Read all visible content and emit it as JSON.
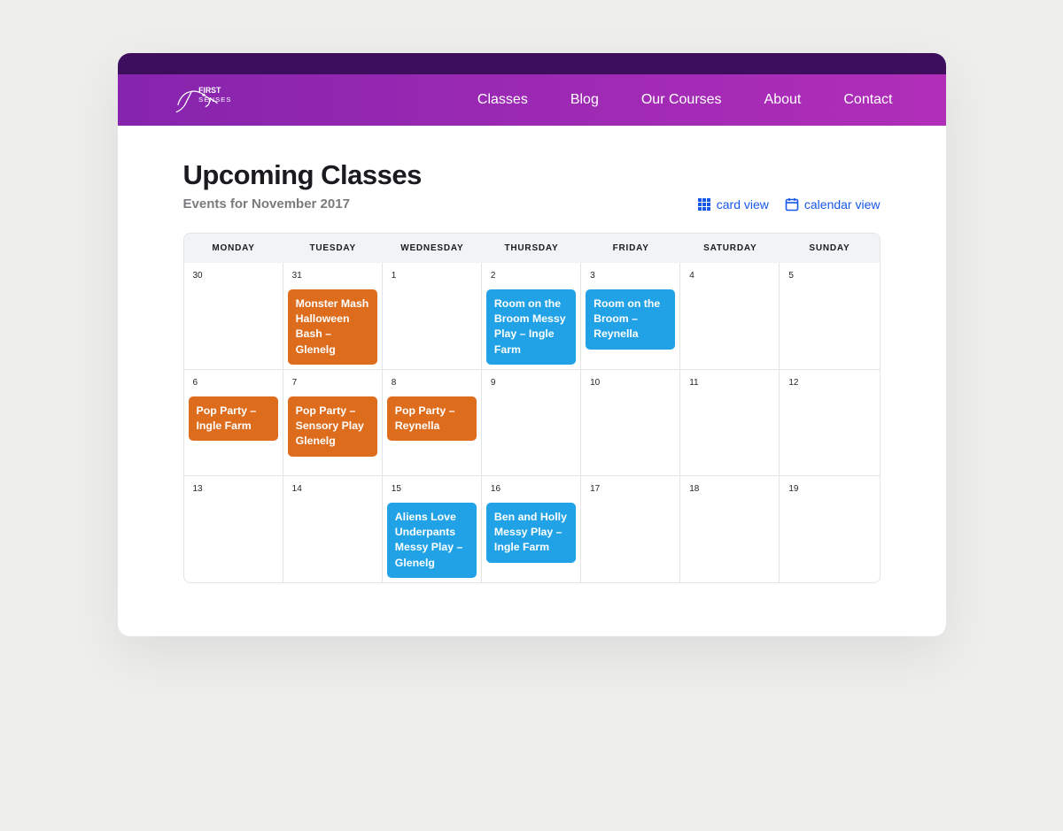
{
  "nav": {
    "logo_text": "FIRST SENSES",
    "links": [
      "Classes",
      "Blog",
      "Our Courses",
      "About",
      "Contact"
    ]
  },
  "header": {
    "title": "Upcoming Classes",
    "subtitle": "Events for November 2017",
    "card_view_label": "card view",
    "calendar_view_label": "calendar view"
  },
  "calendar": {
    "day_headers": [
      "MONDAY",
      "TUESDAY",
      "WEDNESDAY",
      "THURSDAY",
      "FRIDAY",
      "SATURDAY",
      "SUNDAY"
    ],
    "cells": [
      {
        "day": "30",
        "events": []
      },
      {
        "day": "31",
        "events": [
          {
            "title": "Monster Mash Halloween Bash – Glenelg",
            "color": "orange"
          }
        ]
      },
      {
        "day": "1",
        "events": []
      },
      {
        "day": "2",
        "events": [
          {
            "title": "Room on the Broom Messy Play – Ingle Farm",
            "color": "blue"
          }
        ]
      },
      {
        "day": "3",
        "events": [
          {
            "title": "Room on the Broom – Reynella",
            "color": "blue"
          }
        ]
      },
      {
        "day": "4",
        "events": []
      },
      {
        "day": "5",
        "events": []
      },
      {
        "day": "6",
        "events": [
          {
            "title": "Pop Party – Ingle Farm",
            "color": "orange"
          }
        ]
      },
      {
        "day": "7",
        "events": [
          {
            "title": "Pop Party – Sensory Play Glenelg",
            "color": "orange"
          }
        ]
      },
      {
        "day": "8",
        "events": [
          {
            "title": "Pop Party – Reynella",
            "color": "orange"
          }
        ]
      },
      {
        "day": "9",
        "events": []
      },
      {
        "day": "10",
        "events": []
      },
      {
        "day": "11",
        "events": []
      },
      {
        "day": "12",
        "events": []
      },
      {
        "day": "13",
        "events": []
      },
      {
        "day": "14",
        "events": []
      },
      {
        "day": "15",
        "events": [
          {
            "title": "Aliens Love Underpants Messy Play – Glenelg",
            "color": "blue"
          }
        ]
      },
      {
        "day": "16",
        "events": [
          {
            "title": "Ben and Holly Messy Play – Ingle Farm",
            "color": "blue"
          }
        ]
      },
      {
        "day": "17",
        "events": []
      },
      {
        "day": "18",
        "events": []
      },
      {
        "day": "19",
        "events": []
      }
    ]
  }
}
